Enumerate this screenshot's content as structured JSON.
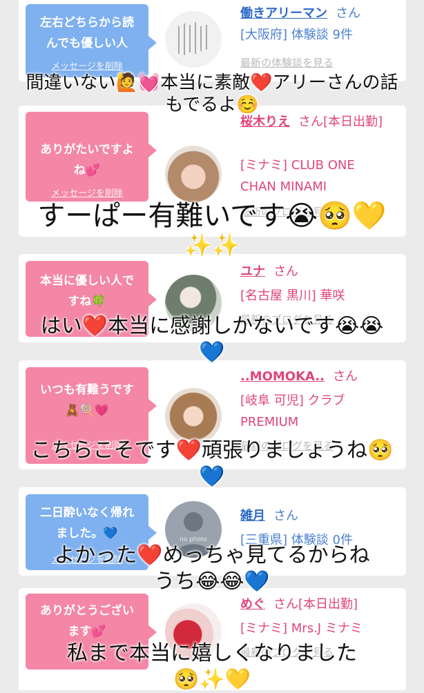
{
  "cards": [
    {
      "bubble_line1": "左右どちらから読",
      "bubble_line2": "んでも優しい人",
      "bubble_color": "blue",
      "delete_label": "メッセージを削除",
      "name": "働きアリーマン",
      "san": "さん",
      "meta1": "[大阪府] 体験談 9件",
      "meta2": "",
      "latest": "最新の体験談を見る",
      "avatar_icon": "handwritten-note-avatar"
    },
    {
      "bubble_line1": "ありがたいですよ",
      "bubble_line2": "ね💕",
      "bubble_color": "pink",
      "delete_label": "メッセージを削除",
      "name": "桜木りえ",
      "san": "さん[本日出勤]",
      "meta1": "[ミナミ] CLUB ONE",
      "meta2": "CHAN MINAMI",
      "latest": "最新のブログを見る",
      "avatar_icon": "woman-photo-avatar"
    },
    {
      "bubble_line1": "本当に優しい人で",
      "bubble_line2": "すね🍀",
      "bubble_color": "pink",
      "delete_label": "",
      "name": "ユナ",
      "san": "さん",
      "meta1": "[名古屋 黒川] 華咲",
      "meta2": "",
      "latest": "最新のブログを見る",
      "avatar_icon": "woman-photo-avatar"
    },
    {
      "bubble_line1": "いつも有難うです",
      "bubble_line2": "🧸🍭💗",
      "bubble_color": "pink",
      "delete_label": "メッセージを削除",
      "name": "..MOMOKA..",
      "san": "さん",
      "meta1": "[岐阜 可児] クラブ",
      "meta2": "PREMIUM",
      "latest": "最新のブログを見る",
      "avatar_icon": "woman-photo-avatar"
    },
    {
      "bubble_line1": "二日酔いなく帰れ",
      "bubble_line2": "ました。💙",
      "bubble_color": "blue",
      "delete_label": "メッセージを削除",
      "name": "雑月",
      "san": "さん",
      "meta1": "[三重県] 体験談 0件",
      "meta2": "",
      "latest": "",
      "avatar_icon": "no-photo-avatar",
      "avatar_text": "no photo"
    },
    {
      "bubble_line1": "ありがとうござい",
      "bubble_line2": "ます💕",
      "bubble_color": "pink",
      "delete_label": "",
      "name": "めぐ",
      "san": "さん[本日出勤]",
      "meta1": "[ミナミ] Mrs.J ミナミ",
      "meta2": "",
      "latest": "最新のブログを見る",
      "avatar_icon": "woman-photo-avatar"
    }
  ],
  "captions": [
    {
      "line1": "間違いない🙋💓本当に素敵❤️アリーさんの話",
      "line2": "もでるよ☺️"
    },
    {
      "line1": "すーぱー有難いです😭🥺💛",
      "line2": "✨✨"
    },
    {
      "line1": "はい❤️本当に感謝しかないです😭😭",
      "line2": "💙"
    },
    {
      "line1": "こちらこそです❤️頑張りましょうね🥺",
      "line2": "💙"
    },
    {
      "line1": "よかった❤️めっちゃ見てるからね",
      "line2": "うち😂😂💙"
    },
    {
      "line1": "私まで本当に嬉しくなりました",
      "line2": "🥺✨💛"
    }
  ],
  "colors": {
    "blue_bubble": "#7fb0ef",
    "pink_bubble": "#f486a6",
    "blue_text": "#2e6ac8",
    "pink_text": "#e0457b",
    "background": "#ebebeb"
  }
}
